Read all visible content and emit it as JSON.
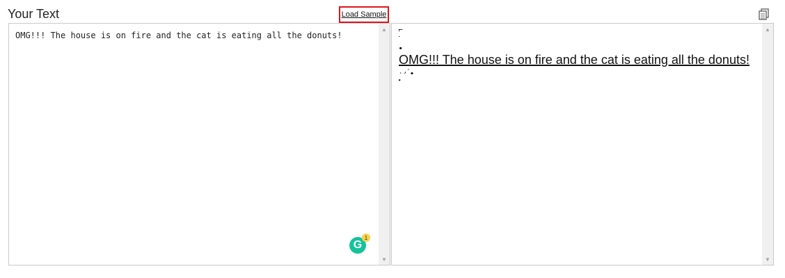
{
  "header": {
    "title": "Your Text",
    "load_sample_label": "Load Sample"
  },
  "input": {
    "text": "OMG!!! The house is on fire and the cat is eating all the donuts!"
  },
  "grammarly": {
    "letter": "G",
    "badge_count": "1"
  },
  "output": {
    "text": "OMG!!! The house is on fire and the cat is eating all the donuts!",
    "noise_above": [
      "͛ͥͮ͛͐͗͛ͥͮ͛͐͗͛ͥͮ͛͐͗̚̚̚͝͠͝͠͝͠",
      "̆̄̅͐̍̎͂̐̆̄̅͐̍̎͂̐̆̄̅͐̍̎",
      "̤̥̦̩̪̫̬̭̮̯̤̥̦̩̪̫̬̭̮̯"
    ],
    "noise_below": [
      "̨̡̛̜̝̞̟̠̣̤̥̦̩̪̫̬̭̮̯",
      "̲̳̹̺̻̼͇͈͉͍͎̲̳̹̺̻̼͇͈͉͍͎"
    ]
  },
  "icons": {
    "copy": "copy-icon",
    "scroll_up": "scroll-up-icon",
    "scroll_down": "scroll-down-icon"
  },
  "colors": {
    "highlight_border": "#e0121b",
    "grammarly": "#15c39a",
    "badge": "#f9d24b"
  }
}
